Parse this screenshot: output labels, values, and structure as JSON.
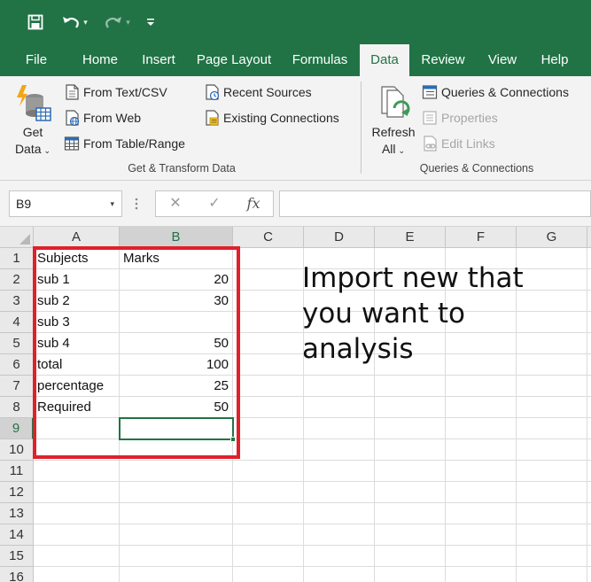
{
  "quick_access": {
    "save": "save-icon",
    "undo": "undo-icon",
    "redo": "redo-icon",
    "customize": "customize-icon"
  },
  "tabs": [
    {
      "label": "File",
      "active": false
    },
    {
      "label": "Home",
      "active": false
    },
    {
      "label": "Insert",
      "active": false
    },
    {
      "label": "Page Layout",
      "active": false
    },
    {
      "label": "Formulas",
      "active": false
    },
    {
      "label": "Data",
      "active": true
    },
    {
      "label": "Review",
      "active": false
    },
    {
      "label": "View",
      "active": false
    },
    {
      "label": "Help",
      "active": false
    }
  ],
  "ribbon": {
    "get_transform": {
      "get_data_line1": "Get",
      "get_data_line2": "Data",
      "from_text_csv": "From Text/CSV",
      "from_web": "From Web",
      "from_table_range": "From Table/Range",
      "recent_sources": "Recent Sources",
      "existing_connections": "Existing Connections",
      "group_label": "Get & Transform Data"
    },
    "queries": {
      "refresh_line1": "Refresh",
      "refresh_line2": "All",
      "queries_connections": "Queries & Connections",
      "properties": "Properties",
      "edit_links": "Edit Links",
      "group_label": "Queries & Connections"
    }
  },
  "formula_bar": {
    "name_box": "B9",
    "cancel_symbol": "✕",
    "enter_symbol": "✓",
    "function_symbol": "fx",
    "formula": ""
  },
  "sheet": {
    "columns": [
      "A",
      "B",
      "C",
      "D",
      "E",
      "F",
      "G"
    ],
    "rows": [
      "1",
      "2",
      "3",
      "4",
      "5",
      "6",
      "7",
      "8",
      "9",
      "10",
      "11",
      "12",
      "13",
      "14",
      "15",
      "16"
    ],
    "active_cell": "B9",
    "cells": [
      {
        "a": "Subjects",
        "b": "Marks"
      },
      {
        "a": "sub 1",
        "b": "20"
      },
      {
        "a": "sub 2",
        "b": "30"
      },
      {
        "a": "sub 3",
        "b": ""
      },
      {
        "a": "sub 4",
        "b": "50"
      },
      {
        "a": "total",
        "b": "100"
      },
      {
        "a": "percentage",
        "b": "25"
      },
      {
        "a": "Required",
        "b": "50"
      },
      {
        "a": "",
        "b": ""
      },
      {
        "a": "",
        "b": ""
      }
    ],
    "annotation": "Import new that you want to analysis",
    "highlight_color": "#e0202a",
    "accent_color": "#217346"
  }
}
